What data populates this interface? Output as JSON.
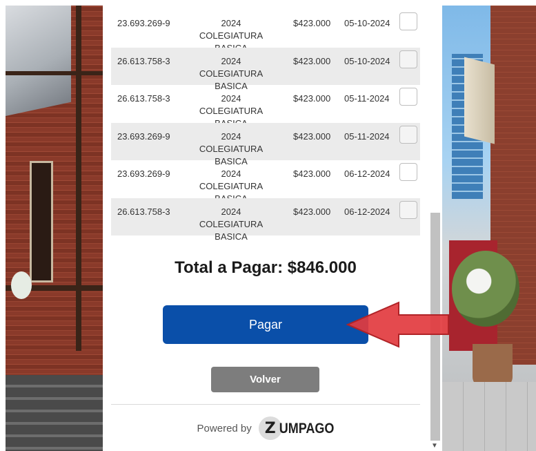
{
  "payments": {
    "rows": [
      {
        "rut": "23.693.269-9",
        "desc_line1": "2024 COLEGIATURA",
        "desc_line2": "BASICA",
        "amount": "$423.000",
        "date": "05-10-2024"
      },
      {
        "rut": "26.613.758-3",
        "desc_line1": "2024 COLEGIATURA",
        "desc_line2": "BASICA",
        "amount": "$423.000",
        "date": "05-10-2024"
      },
      {
        "rut": "26.613.758-3",
        "desc_line1": "2024 COLEGIATURA",
        "desc_line2": "BASICA",
        "amount": "$423.000",
        "date": "05-11-2024"
      },
      {
        "rut": "23.693.269-9",
        "desc_line1": "2024 COLEGIATURA",
        "desc_line2": "BASICA",
        "amount": "$423.000",
        "date": "05-11-2024"
      },
      {
        "rut": "23.693.269-9",
        "desc_line1": "2024 COLEGIATURA",
        "desc_line2": "BASICA",
        "amount": "$423.000",
        "date": "06-12-2024"
      },
      {
        "rut": "26.613.758-3",
        "desc_line1": "2024 COLEGIATURA",
        "desc_line2": "BASICA",
        "amount": "$423.000",
        "date": "06-12-2024"
      }
    ]
  },
  "summary": {
    "total_label": "Total a Pagar: $846.000"
  },
  "actions": {
    "pay_label": "Pagar",
    "back_label": "Volver"
  },
  "footer": {
    "powered_by": "Powered by",
    "logo_mark": "Z",
    "logo_text": "UMPAGO"
  },
  "colors": {
    "pay_button": "#0a4fa9",
    "back_button": "#7d7d7d",
    "arrow": "#e23b3f",
    "row_alt": "#ebebeb"
  },
  "icons": {
    "arrow": "red-left-arrow-icon",
    "scroll": "chevron-down-icon"
  }
}
